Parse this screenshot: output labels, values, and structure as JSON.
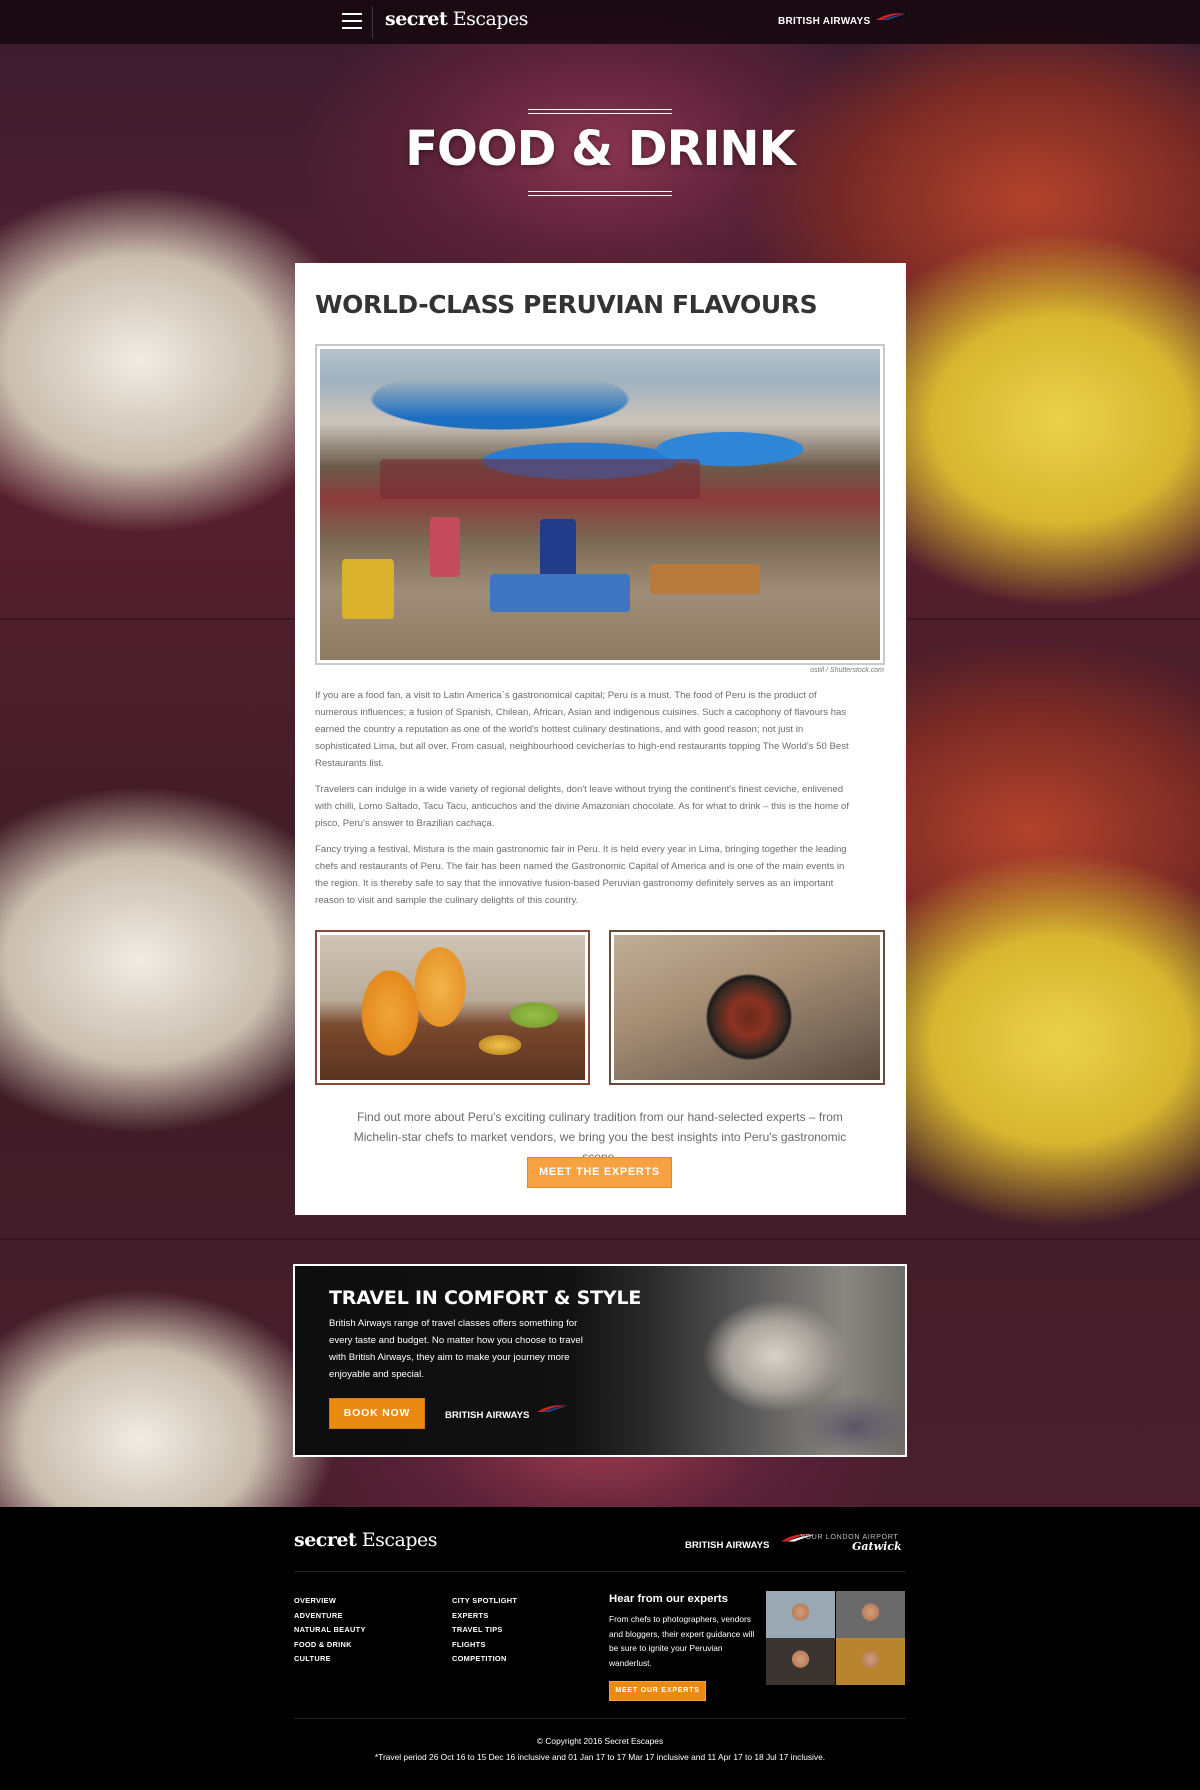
{
  "nav": {
    "brand": {
      "bold": "secret",
      "regular": "Escapes"
    },
    "partner": "BRITISH AIRWAYS"
  },
  "hero": {
    "title": "FOOD & DRINK"
  },
  "article": {
    "title": "WORLD-CLASS PERUVIAN FLAVOURS",
    "photo_credit": "ostill / Shutterstock.com",
    "paragraphs": [
      "If you are a food fan, a visit to Latin America`s gastronomical capital; Peru is a must. The food of Peru is the product of numerous influences; a fusion of Spanish, Chilean, African, Asian and indigenous cuisines. Such a cacophony of flavours has earned the country a reputation as one of the world's hottest culinary destinations, and with good reason; not just in sophisticated Lima, but all over. From casual, neighbourhood cevicherías to high-end restaurants topping The World's 50 Best Restaurants list.",
      "Travelers can indulge in a wide variety of regional delights, don't leave without trying the continent's finest ceviche, enlivened with chilli, Lomo Saltado, Tacu Tacu, anticuchos and the divine Amazonian chocolate. As for what to drink – this is the home of pisco, Peru's answer to Brazilian cachaça.",
      "Fancy trying a festival, Mistura is the main gastronomic fair in Peru. It is held every year in Lima, bringing together the leading chefs and restaurants of Peru. The fair has been named the Gastronomic Capital of America and is one of the main events in the region. It is thereby safe to say that the innovative fusion-based Peruvian gastronomy definitely serves as an important reason to visit and sample the culinary delights of this country."
    ],
    "cta_text": "Find out more about Peru's exciting culinary tradition from our hand-selected experts – from Michelin-star chefs to market vendors, we bring you the best insights into Peru's gastronomic scene.",
    "cta_button": "MEET THE EXPERTS"
  },
  "banner": {
    "title": "TRAVEL IN COMFORT & STYLE",
    "text": "British Airways range of travel classes offers something for every taste and budget. No matter how you choose to travel with British Airways, they aim to make your journey more enjoyable and special.",
    "button": "BOOK NOW",
    "partner": "BRITISH AIRWAYS"
  },
  "footer": {
    "brand": {
      "bold": "secret",
      "regular": "Escapes"
    },
    "partner": "BRITISH AIRWAYS",
    "airport_small": "YOUR LONDON AIRPORT",
    "airport_name": "Gatwick",
    "links_col1": [
      "OVERVIEW",
      "ADVENTURE",
      "NATURAL BEAUTY",
      "FOOD & DRINK",
      "CULTURE"
    ],
    "links_col2": [
      "CITY SPOTLIGHT",
      "EXPERTS",
      "TRAVEL TIPS",
      "FLIGHTS",
      "COMPETITION"
    ],
    "experts_title": "Hear from our experts",
    "experts_text": "From chefs to photographers, vendors and bloggers, their expert guidance will be sure to ignite your Peruvian wanderlust.",
    "experts_button": "MEET OUR EXPERTS",
    "copyright": "© Copyright 2016 Secret Escapes",
    "disclaimer": "*Travel period 26 Oct 16 to 15 Dec 16 inclusive and 01 Jan 17 to 17 Mar 17 inclusive and 11 Apr 17 to 18 Jul 17 inclusive."
  },
  "colors": {
    "accent_orange": "#f6a243",
    "banner_button": "#e98b12",
    "ba_red": "#d2232a",
    "text_dark": "#333333",
    "text_body": "#6d6d6d"
  }
}
